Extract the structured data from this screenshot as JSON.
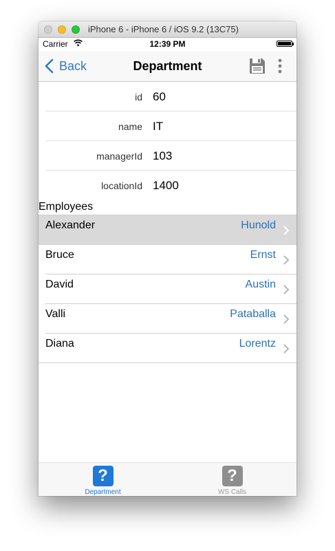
{
  "window": {
    "title": "iPhone 6 - iPhone 6 / iOS 9.2 (13C75)"
  },
  "status": {
    "carrier": "Carrier",
    "time": "12:39 PM"
  },
  "nav": {
    "back_label": "Back",
    "title": "Department"
  },
  "fields": [
    {
      "label": "id",
      "value": "60"
    },
    {
      "label": "name",
      "value": "IT"
    },
    {
      "label": "managerId",
      "value": "103"
    },
    {
      "label": "locationId",
      "value": "1400"
    }
  ],
  "employees_header": "Employees",
  "employees": [
    {
      "first": "Alexander",
      "last": "Hunold"
    },
    {
      "first": "Bruce",
      "last": "Ernst"
    },
    {
      "first": "David",
      "last": "Austin"
    },
    {
      "first": "Valli",
      "last": "Pataballa"
    },
    {
      "first": "Diana",
      "last": "Lorentz"
    }
  ],
  "tabs": [
    {
      "label": "Department",
      "icon": "question-icon",
      "selected": true
    },
    {
      "label": "WS Calls",
      "icon": "question-icon",
      "selected": false
    }
  ],
  "colors": {
    "accent": "#2e78c8",
    "last_name": "#2e6fb5",
    "selected_row": "#d9d9d9",
    "tab_active": "#1e7ad6"
  }
}
